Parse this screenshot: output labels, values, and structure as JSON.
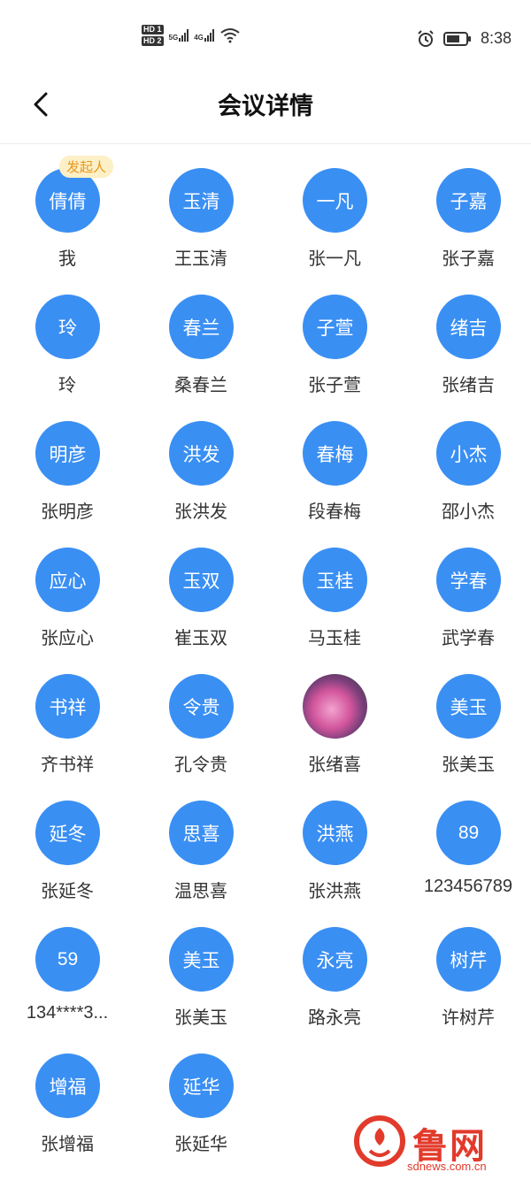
{
  "status_bar": {
    "hd1": "HD 1",
    "hd2": "HD 2",
    "net1": "5G",
    "net2": "4G",
    "time": "8:38",
    "icons": [
      "signal-icon",
      "wifi-icon",
      "alarm-icon",
      "battery-icon"
    ]
  },
  "header": {
    "title": "会议详情",
    "back_icon": "chevron-left-icon"
  },
  "initiator_badge": "发起人",
  "participants": [
    {
      "avatar": "倩倩",
      "name": "我"
    },
    {
      "avatar": "玉清",
      "name": "王玉清"
    },
    {
      "avatar": "一凡",
      "name": "张一凡"
    },
    {
      "avatar": "子嘉",
      "name": "张子嘉"
    },
    {
      "avatar": "玲",
      "name": "玲"
    },
    {
      "avatar": "春兰",
      "name": "桑春兰"
    },
    {
      "avatar": "子萱",
      "name": "张子萱"
    },
    {
      "avatar": "绪吉",
      "name": "张绪吉"
    },
    {
      "avatar": "明彦",
      "name": "张明彦"
    },
    {
      "avatar": "洪发",
      "name": "张洪发"
    },
    {
      "avatar": "春梅",
      "name": "段春梅"
    },
    {
      "avatar": "小杰",
      "name": "邵小杰"
    },
    {
      "avatar": "应心",
      "name": "张应心"
    },
    {
      "avatar": "玉双",
      "name": "崔玉双"
    },
    {
      "avatar": "玉桂",
      "name": "马玉桂"
    },
    {
      "avatar": "学春",
      "name": "武学春"
    },
    {
      "avatar": "书祥",
      "name": "齐书祥"
    },
    {
      "avatar": "令贵",
      "name": "孔令贵"
    },
    {
      "avatar": "",
      "name": "张绪喜"
    },
    {
      "avatar": "美玉",
      "name": "张美玉"
    },
    {
      "avatar": "延冬",
      "name": "张延冬"
    },
    {
      "avatar": "思喜",
      "name": "温思喜"
    },
    {
      "avatar": "洪燕",
      "name": "张洪燕"
    },
    {
      "avatar": "89",
      "name": "123456789"
    },
    {
      "avatar": "59",
      "name": "134****3..."
    },
    {
      "avatar": "美玉",
      "name": "张美玉"
    },
    {
      "avatar": "永亮",
      "name": "路永亮"
    },
    {
      "avatar": "树芹",
      "name": "许树芹"
    },
    {
      "avatar": "增福",
      "name": "张增福"
    },
    {
      "avatar": "延华",
      "name": "张延华"
    }
  ],
  "watermark": {
    "name": "鲁网",
    "url": "sdnews.com.cn"
  },
  "colors": {
    "avatar_bg": "#3a8ff3",
    "badge_bg": "#fdf0c6",
    "badge_text": "#e8961c",
    "watermark": "#e23a2b"
  }
}
